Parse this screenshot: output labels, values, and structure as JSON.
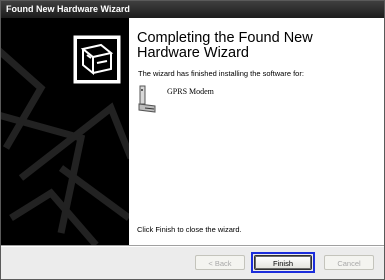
{
  "window": {
    "title": "Found New Hardware Wizard"
  },
  "content": {
    "heading": "Completing the Found New Hardware Wizard",
    "subtext": "The wizard has finished installing the software for:",
    "device_icon": "modem-icon",
    "device_name": "GPRS Modem",
    "finish_note": "Click Finish to close the wizard."
  },
  "buttons": {
    "back": {
      "label": "< Back",
      "enabled": false
    },
    "finish": {
      "label": "Finish",
      "enabled": true,
      "highlighted": true
    },
    "cancel": {
      "label": "Cancel",
      "enabled": false
    }
  },
  "banner": {
    "icon": "hardware-wizard-icon"
  },
  "colors": {
    "titlebar": "#1c1c1c",
    "highlight_border": "#1b2ddb",
    "left_panel": "#000000"
  }
}
